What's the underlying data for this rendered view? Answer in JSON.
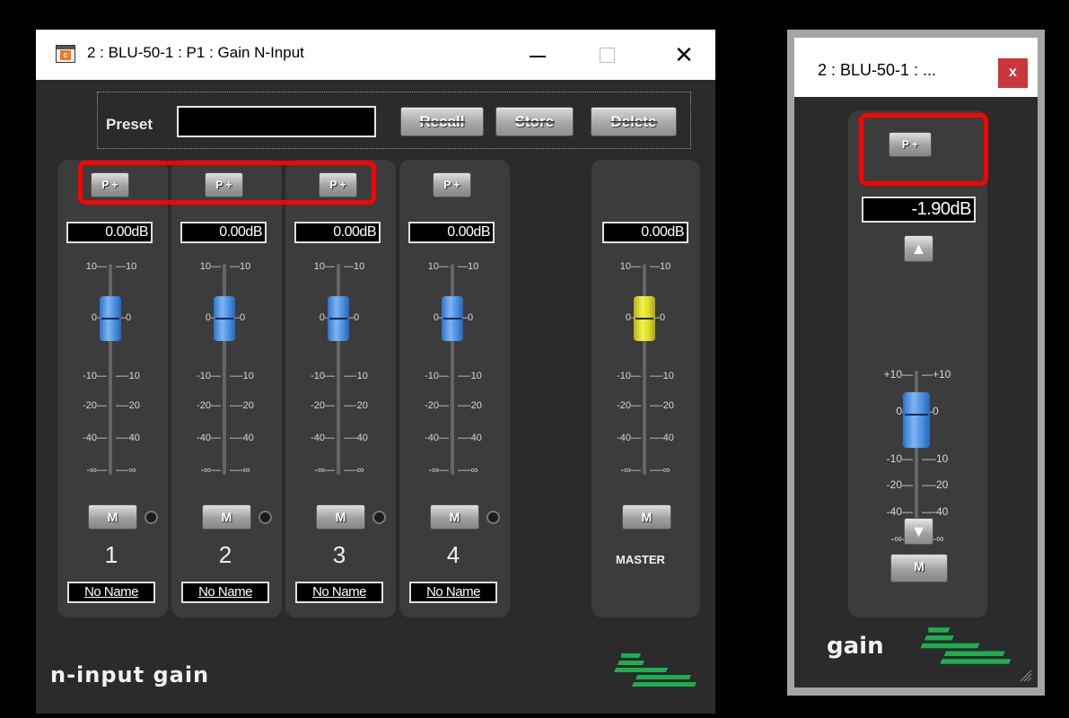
{
  "window1": {
    "title": "2 : BLU-50-1 : P1 : Gain N-Input",
    "controls": {
      "minimize": "minimize",
      "maximize": "maximize",
      "close": "✕"
    },
    "preset": {
      "label": "Preset",
      "value": "",
      "recall": "Recall",
      "store": "Store",
      "delete": "Delete"
    },
    "scale_left": [
      "10",
      "0",
      "-10",
      "-20",
      "-40",
      "-∞"
    ],
    "scale_right": [
      "10",
      "0",
      "-10",
      "-20",
      "-40",
      "-∞"
    ],
    "channels": [
      {
        "p_label": "P +",
        "gain": "0.00dB",
        "mute": "M",
        "number": "1",
        "name": "No Name",
        "fader_level_db": 0
      },
      {
        "p_label": "P +",
        "gain": "0.00dB",
        "mute": "M",
        "number": "2",
        "name": "No Name",
        "fader_level_db": 0
      },
      {
        "p_label": "P +",
        "gain": "0.00dB",
        "mute": "M",
        "number": "3",
        "name": "No Name",
        "fader_level_db": 0
      },
      {
        "p_label": "P +",
        "gain": "0.00dB",
        "mute": "M",
        "number": "4",
        "name": "No Name",
        "fader_level_db": 0
      }
    ],
    "master": {
      "gain": "0.00dB",
      "mute": "M",
      "label": "MASTER",
      "fader_level_db": 0,
      "fader_color": "#e6e62e"
    },
    "footer": "n-input gain"
  },
  "window2": {
    "title": "2 : BLU-50-1 : ...",
    "close": "x",
    "p_label": "P +",
    "gain": "-1.90dB",
    "up": "▲",
    "down": "▼",
    "mute": "M",
    "scale_left": [
      "+10",
      "0",
      "-10",
      "-20",
      "-40",
      "-∞"
    ],
    "scale_right": [
      "+10",
      "0",
      "-10",
      "-20",
      "-40",
      "-∞"
    ],
    "fader_level_db": -1.9,
    "footer": "gain"
  },
  "colors": {
    "highlight": "#ff0000",
    "logo_green": "#1fae4f",
    "fader_blue": "#4b90e0",
    "panel": "#3c3c3c",
    "window_bg": "#2b2b2b"
  }
}
